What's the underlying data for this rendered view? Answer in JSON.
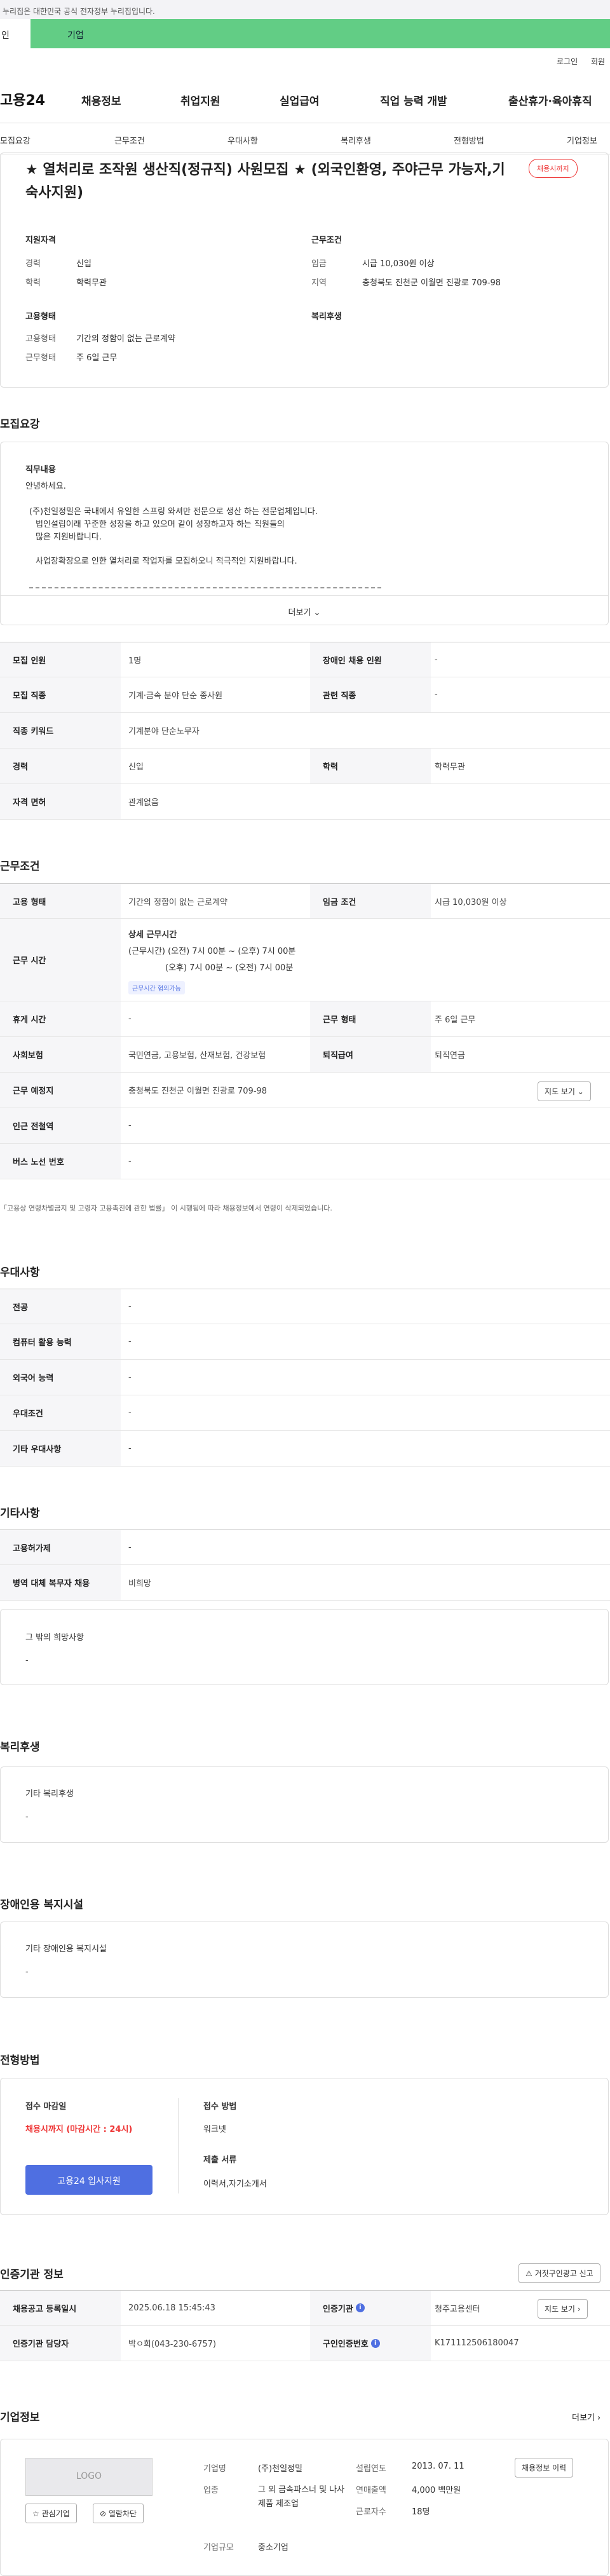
{
  "gov": "누리집은 대한민국 공식 전자정부 누리집입니다.",
  "usr": {
    "a": "인",
    "b": "기업"
  },
  "util": {
    "login": "로그인",
    "join": "회원"
  },
  "logo": "고용24",
  "gnb": [
    "채용정보",
    "취업지원",
    "실업급여",
    "직업 능력 개발",
    "출산휴가·육아휴직"
  ],
  "tabs": [
    "모집요강",
    "근무조건",
    "우대사항",
    "복리후생",
    "전형방법",
    "기업정보"
  ],
  "title": "★ 열처리로 조작원 생산직(정규직) 사원모집 ★ (외국인환영, 주야근무 가능자,기숙사지원)",
  "badge": "채용시까지",
  "summary": {
    "qualify": "지원자격",
    "exp_k": "경력",
    "exp_v": "신입",
    "edu_k": "학력",
    "edu_v": "학력무관",
    "cond": "근무조건",
    "wage_k": "임금",
    "wage_v": "시급 10,030원 이상",
    "area_k": "지역",
    "area_v": "충청북도 진천군 이월면 진광로 709-98",
    "emp": "고용형태",
    "type_k": "고용형태",
    "type_v": "기간의 정함이 없는 근로계약",
    "work_k": "근무형태",
    "work_v": "주 6일 근무",
    "welfare": "복리후생"
  },
  "s1": "모집요강",
  "duty": {
    "h": "직무내용",
    "l1": "안녕하세요.",
    "l2": "(주)천일정밀은 국내에서 유일한 스프링 와셔만 전문으로 생산 하는 전문업체입니다.",
    "l3": "법인설립이래 꾸준한 성장을 하고 있으며 같이 성장하고자 하는 직원들의",
    "l4": "많은 지원바랍니다.",
    "l5": "사업장확장으로 인한 열처리로 작업자를 모집하오니 적극적인 지원바랍니다.",
    "more": "더보기"
  },
  "t1": [
    [
      "모집 인원",
      "1명",
      "장애인 채용 인원",
      "-"
    ],
    [
      "모집 직종",
      "기계·금속 분야 단순 종사원",
      "관련 직종",
      "-"
    ],
    [
      "직종 키워드",
      "기계분야 단순노무자"
    ],
    [
      "경력",
      "신입",
      "학력",
      "학력무관"
    ],
    [
      "자격 면허",
      "관계없음"
    ]
  ],
  "s2": "근무조건",
  "t2": {
    "r1": [
      "고용 형태",
      "기간의 정함이 없는 근로계약",
      "임금 조건",
      "시급 10,030원 이상"
    ],
    "wt": "근무 시간",
    "wth": "상세 근무시간",
    "w1": "(근무시간) (오전) 7시 00분 ~ (오후) 7시 00분",
    "w2": "(오후) 7시 00분 ~ (오전) 7시 00분",
    "wtag": "근무시간 협의가능",
    "r3": [
      "휴게 시간",
      "-",
      "근무 형태",
      "주 6일 근무"
    ],
    "r4": [
      "사회보험",
      "국민연금, 고용보험, 산재보험, 건강보험",
      "퇴직급여",
      "퇴직연금"
    ],
    "r5": [
      "근무 예정지",
      "충청북도 진천군 이월면 진광로 709-98"
    ],
    "map": "지도 보기",
    "r6": [
      "인근 전철역",
      "-"
    ],
    "r7": [
      "버스 노선 번호",
      "-"
    ]
  },
  "note": "「고용상 연령차별금지 및 고령자 고용촉진에 관한 법률」 이 시행됨에 따라 채용정보에서 연령이 삭제되었습니다.",
  "s3": "우대사항",
  "t3": [
    [
      "전공",
      "-"
    ],
    [
      "컴퓨터 활용 능력",
      "-"
    ],
    [
      "외국어 능력",
      "-"
    ],
    [
      "우대조건",
      "-"
    ],
    [
      "기타 우대사항",
      "-"
    ]
  ],
  "s4": "기타사항",
  "t4": [
    [
      "고용허가제",
      "-"
    ],
    [
      "병역 대체 복무자 채용",
      "비희망"
    ]
  ],
  "etc": {
    "h": "그 밖의 희망사항",
    "v": "-"
  },
  "s5": "복리후생",
  "wel": {
    "h": "기타 복리후생",
    "v": "-"
  },
  "s6": "장애인용 복지시설",
  "dis": {
    "h": "기타 장애인용 복지시설",
    "v": "-"
  },
  "s7": "전형방법",
  "sel": {
    "dl": "접수 마감일",
    "dlv": "채용시까지 (마감시간 : 24시)",
    "apply": "고용24 입사지원",
    "m": "접수 방법",
    "mv": "워크넷",
    "doc": "제출 서류",
    "docv": "이력서,자기소개서"
  },
  "s8": "인증기관 정보",
  "report": "거짓구인광고 신고",
  "t8": [
    [
      "채용공고 등록일시",
      "2025.06.18 15:45:43",
      "인증기관",
      "청주고용센터"
    ],
    [
      "인증기관 담당자",
      "박ㅇ희(043-230-6757)",
      "구인인증번호",
      "K171112506180047"
    ]
  ],
  "s9": "기업정보",
  "more9": "더보기",
  "co": {
    "logo": "LOGO",
    "fav": "관심기업",
    "blk": "열람차단",
    "nk": "기업명",
    "nv": "(주)천일정밀",
    "bk": "업종",
    "bv": "그 외 금속파스너 및 나사제품 제조업",
    "sk": "기업규모",
    "sv": "중소기업",
    "ek": "설립연도",
    "ev": "2013. 07. 11",
    "rk": "연매출액",
    "rv": "4,000 백만원",
    "wk": "근로자수",
    "wv": "18명",
    "hist": "채용정보 이력"
  }
}
